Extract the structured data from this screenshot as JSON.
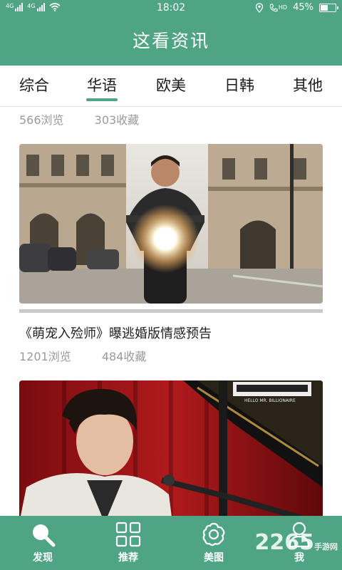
{
  "status": {
    "sim1_tag": "4G",
    "sim2_tag": "4G",
    "time": "18:02",
    "volte": "HD",
    "battery": "45%"
  },
  "app": {
    "title": "这看资讯"
  },
  "tabs": [
    {
      "label": "综合",
      "active": false
    },
    {
      "label": "华语",
      "active": true
    },
    {
      "label": "欧美",
      "active": false
    },
    {
      "label": "日韩",
      "active": false
    },
    {
      "label": "其他",
      "active": false
    }
  ],
  "feed": {
    "prev_item": {
      "views": "566浏览",
      "favs": "303收藏"
    },
    "item1": {
      "title": "《萌宠入殓师》曝逃婚版情感预告",
      "views": "1201浏览",
      "favs": "484收藏"
    },
    "item2": {
      "poster_text": "HELLO MR. BILLIONAIRE"
    }
  },
  "nav": [
    {
      "label": "发现",
      "icon": "search-icon"
    },
    {
      "label": "推荐",
      "icon": "grid-icon"
    },
    {
      "label": "美图",
      "icon": "flower-icon"
    },
    {
      "label": "我",
      "icon": "person-icon"
    }
  ],
  "watermark": {
    "number": "2265",
    "text": "手游网"
  },
  "colors": {
    "brand": "#4fa486",
    "meta_text": "#9a9a9a"
  }
}
